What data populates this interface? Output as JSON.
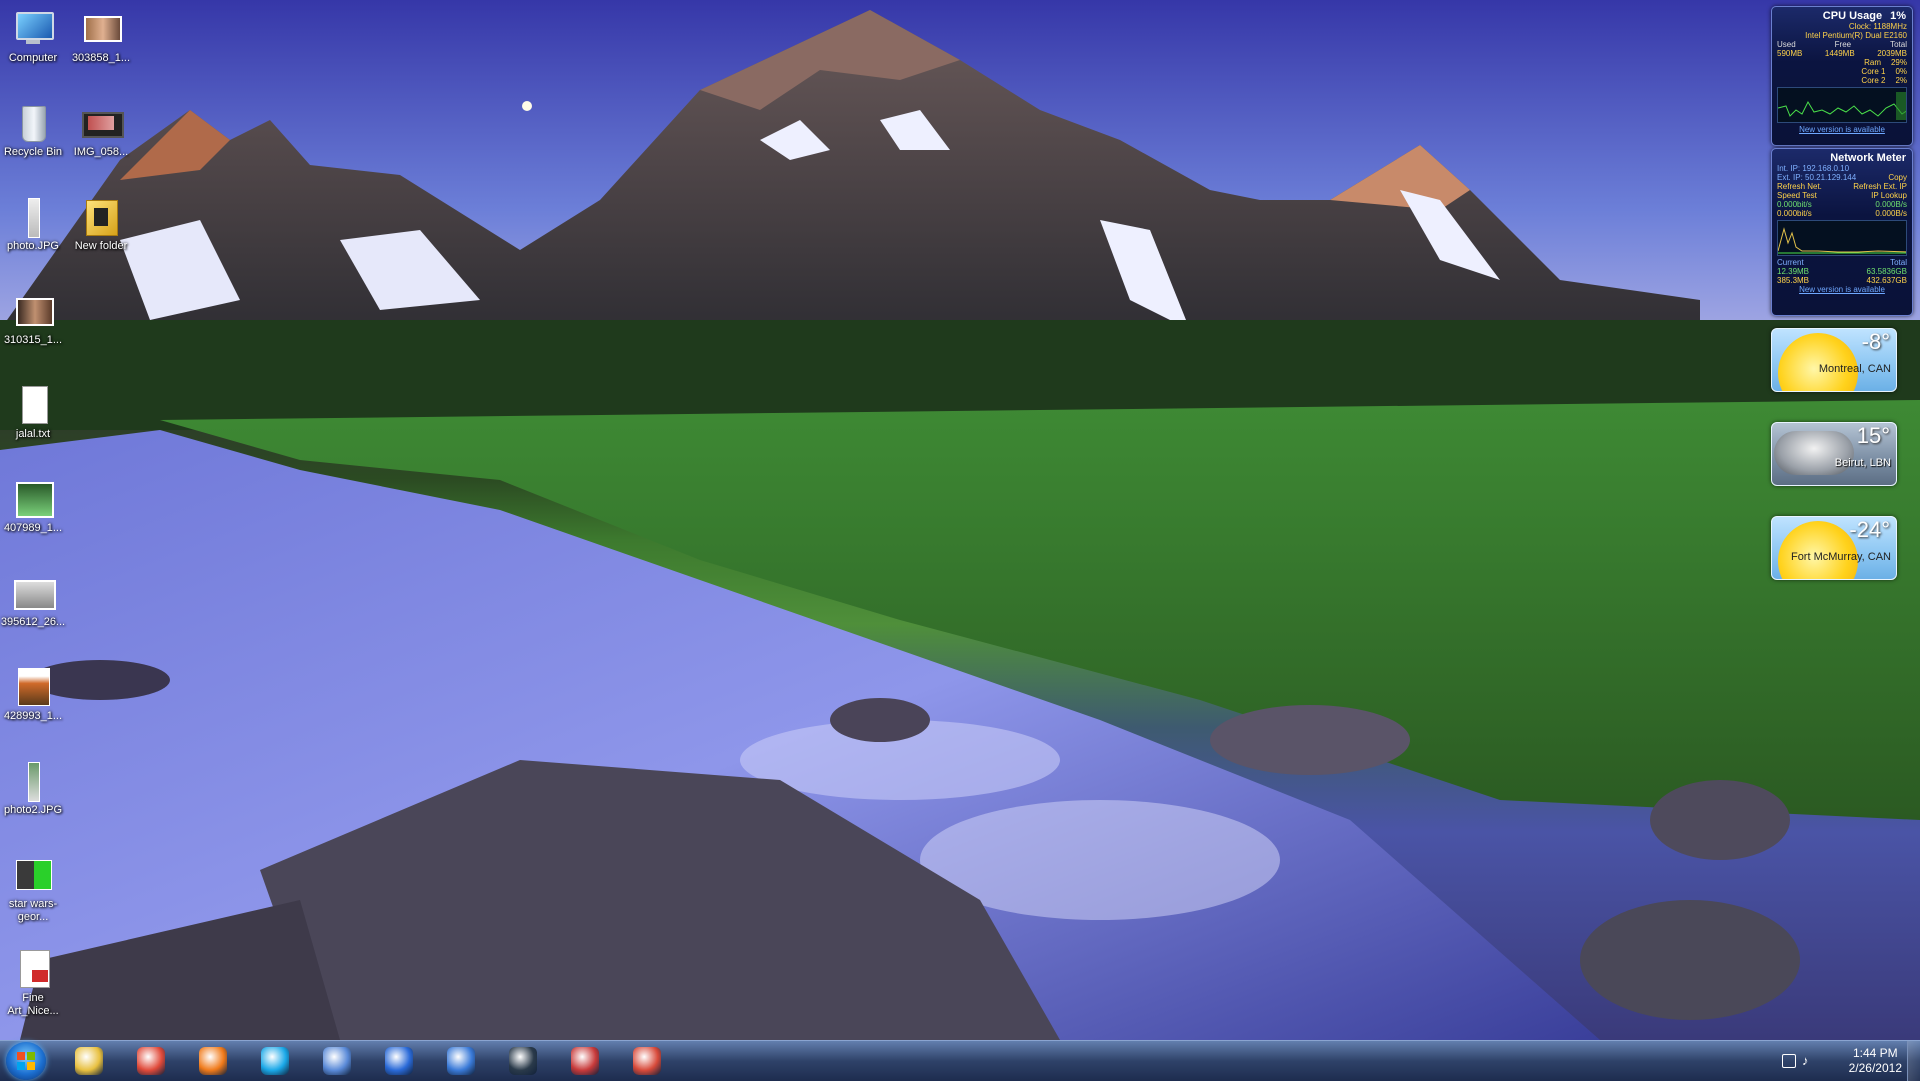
{
  "desktop_icons": [
    {
      "label": "Computer",
      "icon": "computer-icon"
    },
    {
      "label": "303858_1...",
      "icon": "image-file-icon"
    },
    {
      "label": "Recycle Bin",
      "icon": "recycle-bin-icon"
    },
    {
      "label": "IMG_058...",
      "icon": "video-file-icon"
    },
    {
      "label": "photo.JPG",
      "icon": "image-file-icon"
    },
    {
      "label": "New folder",
      "icon": "folder-icon"
    },
    {
      "label": "310315_1...",
      "icon": "image-file-icon"
    },
    {
      "label": "jalal.txt",
      "icon": "text-file-icon"
    },
    {
      "label": "407989_1...",
      "icon": "image-file-icon"
    },
    {
      "label": "395612_26...",
      "icon": "image-file-icon"
    },
    {
      "label": "428993_1...",
      "icon": "image-file-icon"
    },
    {
      "label": "photo2.JPG",
      "icon": "image-file-icon"
    },
    {
      "label": "star wars-geor...",
      "icon": "image-file-icon"
    },
    {
      "label": "Fine Art_Nice...",
      "icon": "pdf-file-icon"
    }
  ],
  "cpu_gadget": {
    "title": "CPU Usage",
    "usage": "1%",
    "clock": "Clock: 1188MHz",
    "processor": "Intel Pentium(R) Dual E2160",
    "headers": {
      "used": "Used",
      "free": "Free",
      "total": "Total"
    },
    "mem": {
      "used": "590MB",
      "free": "1449MB",
      "total": "2039MB"
    },
    "ram_label": "Ram",
    "ram": "29%",
    "core1_label": "Core 1",
    "core1": "0%",
    "core2_label": "Core 2",
    "core2": "2%",
    "update": "New version is available"
  },
  "network_gadget": {
    "title": "Network Meter",
    "int_ip": "Int. IP:  192.168.0.10",
    "ext_ip": "Ext. IP:  50.21.129.144",
    "copy": "Copy",
    "refresh_net": "Refresh Net.",
    "refresh_ext": "Refresh Ext. IP",
    "speed_test": "Speed Test",
    "ip_lookup": "IP Lookup",
    "up_rate1": "0.000bit/s",
    "up_rate2": "0.000B/s",
    "down_rate1": "0.000bit/s",
    "down_rate2": "0.000B/s",
    "current_label": "Current",
    "total_label": "Total",
    "cur_up": "12.39MB",
    "tot_up": "63.5836GB",
    "cur_down": "385.3MB",
    "tot_down": "432.637GB",
    "update": "New version is available"
  },
  "weather": [
    {
      "temp": "-8°",
      "city": "Montreal, CAN",
      "condition": "sunny"
    },
    {
      "temp": "15°",
      "city": "Beirut, LBN",
      "condition": "cloudy"
    },
    {
      "temp": "-24°",
      "city": "Fort McMurray, CAN",
      "condition": "sunny"
    }
  ],
  "taskbar": {
    "pinned": [
      {
        "name": "windows-explorer",
        "color": "#e8c040"
      },
      {
        "name": "google-chrome",
        "color": "#e04a3a"
      },
      {
        "name": "firefox",
        "color": "#f07a1a"
      },
      {
        "name": "skype",
        "color": "#1aa8e8"
      },
      {
        "name": "messenger",
        "color": "#5a8ad8"
      },
      {
        "name": "itunes",
        "color": "#2a6ad8"
      },
      {
        "name": "google-earth",
        "color": "#3a7ad8"
      },
      {
        "name": "steam",
        "color": "#2a3a4a"
      },
      {
        "name": "notepad",
        "color": "#c83a3a"
      },
      {
        "name": "app",
        "color": "#d84a3a"
      }
    ],
    "time": "1:44 PM",
    "date": "2/26/2012"
  }
}
